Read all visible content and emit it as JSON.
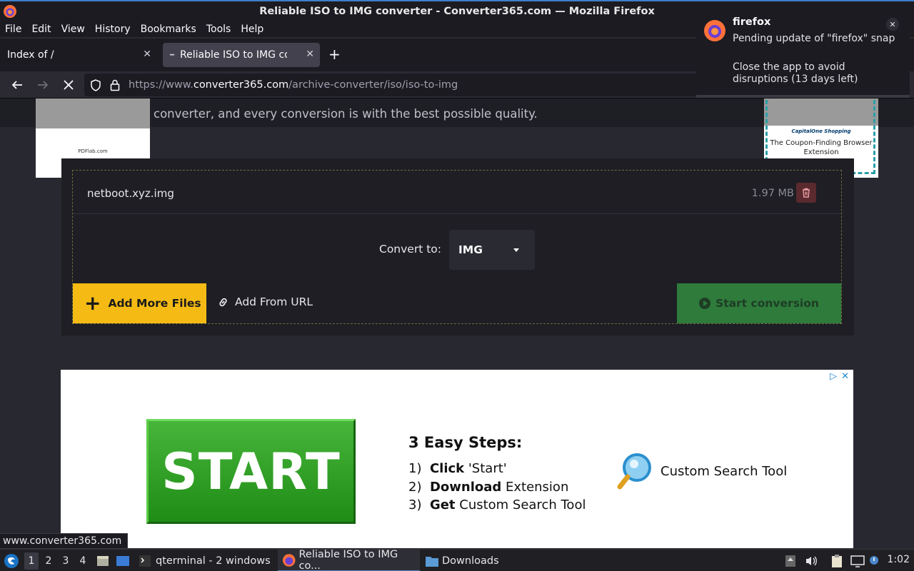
{
  "window": {
    "title": "Reliable ISO to IMG converter - Converter365.com — Mozilla Firefox"
  },
  "menu": {
    "items": [
      "File",
      "Edit",
      "View",
      "History",
      "Bookmarks",
      "Tools",
      "Help"
    ]
  },
  "tabs": [
    {
      "label": "Index of /"
    },
    {
      "label": "Reliable ISO to IMG converter"
    }
  ],
  "url": {
    "prefix": "https://www.",
    "domain": "converter365.com",
    "path": "/archive-converter/iso/iso-to-img"
  },
  "page": {
    "hero_text": "converter, and every conversion is with the best possible quality.",
    "ad_left_label": "PDFlab.com",
    "ad_right_brand": "CapitalOne Shopping",
    "ad_right_text": "The Coupon-Finding Browser Extension",
    "file": {
      "name": "netboot.xyz.img",
      "size": "1.97 MB"
    },
    "convert_label": "Convert to:",
    "convert_value": "IMG",
    "add_files": "Add More Files",
    "add_url": "Add From URL",
    "start": "Start conversion"
  },
  "bottom_ad": {
    "start_label": "START",
    "steps_title": "3 Easy Steps:",
    "step1_num": "1)",
    "step1_bold": "Click",
    "step1_rest": " 'Start'",
    "step2_num": "2)",
    "step2_bold": "Download",
    "step2_rest": " Extension",
    "step3_num": "3)",
    "step3_bold": "Get",
    "step3_rest": " Custom Search Tool",
    "tool_label": "Custom Search Tool"
  },
  "status_url": "www.converter365.com",
  "notification": {
    "app": "firefox",
    "line1": "Pending update of \"firefox\" snap",
    "line2": "Close the app to avoid disruptions (13 days left)"
  },
  "taskbar": {
    "workspaces": [
      "1",
      "2",
      "3",
      "4"
    ],
    "terminal": "qterminal - 2 windows",
    "firefox": "Reliable ISO to IMG co...",
    "downloads": "Downloads",
    "clock": "1:02"
  }
}
